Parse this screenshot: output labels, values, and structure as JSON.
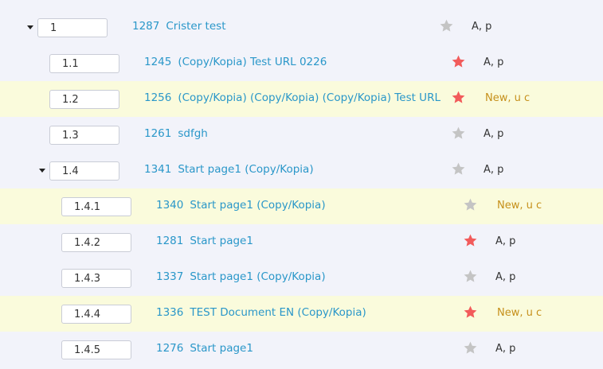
{
  "colors": {
    "link": "#2a97c9",
    "star_active": "#f25b5b",
    "star_inactive": "#c4c4c4",
    "status_new": "#c6901b",
    "status_normal": "#333333",
    "row_highlight": "#fafbdc",
    "row_default": "#f2f3fa"
  },
  "icons": {
    "expand": "chevron-down-icon",
    "favorite": "star-icon"
  },
  "rows": [
    {
      "order": "1",
      "doc_id": "1287",
      "title": "Crister test",
      "starred": false,
      "status": "A, p",
      "status_kind": "normal",
      "highlight": false,
      "expandable": true
    },
    {
      "order": "1.1",
      "doc_id": "1245",
      "title": "(Copy/Kopia) Test URL 0226",
      "starred": true,
      "status": "A, p",
      "status_kind": "normal",
      "highlight": false,
      "expandable": false
    },
    {
      "order": "1.2",
      "doc_id": "1256",
      "title": "(Copy/Kopia) (Copy/Kopia) (Copy/Kopia) Test URL",
      "starred": true,
      "status": "New, u c",
      "status_kind": "new",
      "highlight": true,
      "expandable": false
    },
    {
      "order": "1.3",
      "doc_id": "1261",
      "title": "sdfgh",
      "starred": false,
      "status": "A, p",
      "status_kind": "normal",
      "highlight": false,
      "expandable": false
    },
    {
      "order": "1.4",
      "doc_id": "1341",
      "title": "Start page1 (Copy/Kopia)",
      "starred": false,
      "status": "A, p",
      "status_kind": "normal",
      "highlight": false,
      "expandable": true
    },
    {
      "order": "1.4.1",
      "doc_id": "1340",
      "title": "Start page1 (Copy/Kopia)",
      "starred": false,
      "status": "New, u c",
      "status_kind": "new",
      "highlight": true,
      "expandable": false
    },
    {
      "order": "1.4.2",
      "doc_id": "1281",
      "title": "Start page1",
      "starred": true,
      "status": "A, p",
      "status_kind": "normal",
      "highlight": false,
      "expandable": false
    },
    {
      "order": "1.4.3",
      "doc_id": "1337",
      "title": "Start page1 (Copy/Kopia)",
      "starred": false,
      "status": "A, p",
      "status_kind": "normal",
      "highlight": false,
      "expandable": false
    },
    {
      "order": "1.4.4",
      "doc_id": "1336",
      "title": "TEST Document EN (Copy/Kopia)",
      "starred": true,
      "status": "New, u c",
      "status_kind": "new",
      "highlight": true,
      "expandable": false
    },
    {
      "order": "1.4.5",
      "doc_id": "1276",
      "title": "Start page1",
      "starred": false,
      "status": "A, p",
      "status_kind": "normal",
      "highlight": false,
      "expandable": false
    }
  ]
}
